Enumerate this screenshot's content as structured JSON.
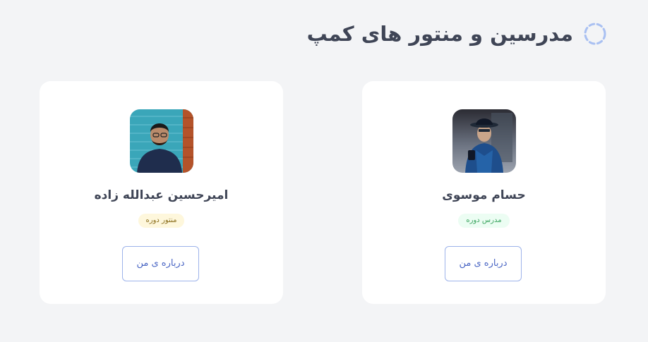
{
  "section": {
    "title": "مدرسین و منتور های کمپ",
    "icon": "loading-spinner-icon",
    "accent_color": "#9db3ea"
  },
  "instructors": [
    {
      "name": "حسام موسوی",
      "role": "مدرس دوره",
      "role_color": "#37a35c",
      "about_label": "درباره ی من"
    },
    {
      "name": "امیرحسین عبدالله زاده",
      "role": "منتور دوره",
      "role_color": "#8a6d1a",
      "about_label": "درباره ی من"
    }
  ]
}
